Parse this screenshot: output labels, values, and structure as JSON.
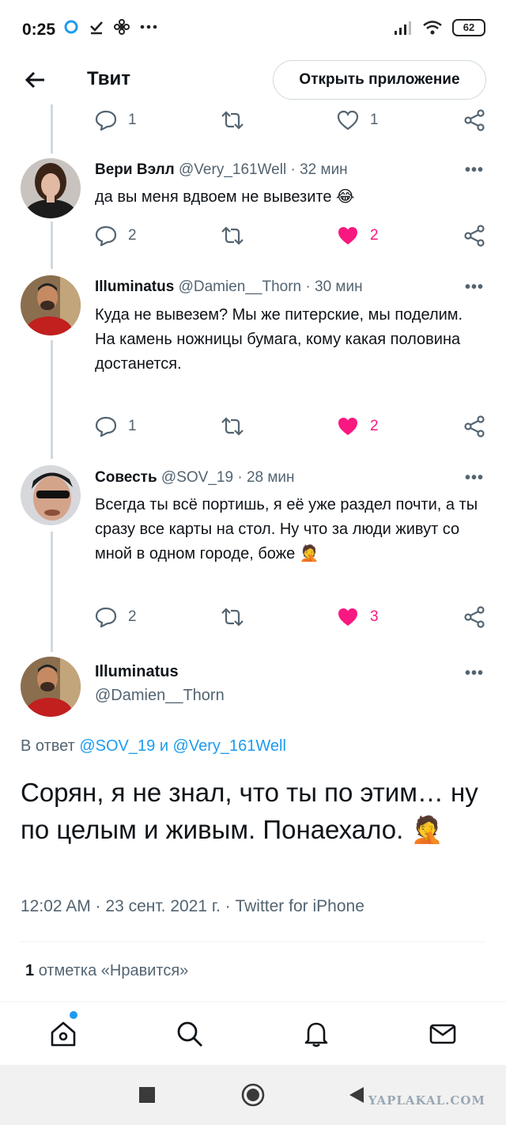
{
  "status_bar": {
    "time": "0:25",
    "battery": "62"
  },
  "header": {
    "title": "Твит",
    "open_app": "Открыть приложение"
  },
  "top_actions": {
    "replies": "1",
    "likes": "1"
  },
  "replies": [
    {
      "name": "Вери Вэлл",
      "handle": "@Very_161Well",
      "time": "32 мин",
      "text": "да вы меня вдвоем не вывезите 😂",
      "reply_count": "2",
      "like_count": "2"
    },
    {
      "name": "Illuminatus",
      "handle": "@Damien__Thorn",
      "time": "30 мин",
      "text": "Куда не вывезем? Мы же питерские, мы поделим.\nНа камень ножницы бумага, кому какая половина достанется.",
      "reply_count": "1",
      "like_count": "2"
    },
    {
      "name": "Совесть",
      "handle": "@SOV_19",
      "time": "28 мин",
      "text": "Всегда ты всё портишь, я её уже раздел почти, а ты сразу все карты на стол. Ну что за люди живут со мной в одном городе, боже 🤦",
      "reply_count": "2",
      "like_count": "3"
    }
  ],
  "main_tweet": {
    "name": "Illuminatus",
    "handle": "@Damien__Thorn",
    "in_reply_prefix": "В ответ",
    "in_reply_user1": "@SOV_19",
    "in_reply_and": "и",
    "in_reply_user2": "@Very_161Well",
    "text": "Сорян, я не знал, что ты по этим… ну по целым и живым. Понаехало. 🤦",
    "meta": "12:02 AM · 23 сент. 2021 г. · Twitter for iPhone",
    "likes_count": "1",
    "likes_label": "отметка «Нравится»"
  },
  "watermark": "YAPLAKAL.COM",
  "colors": {
    "accent": "#1d9bf0",
    "like": "#f91880",
    "muted": "#536471",
    "line": "#cfd9de"
  }
}
